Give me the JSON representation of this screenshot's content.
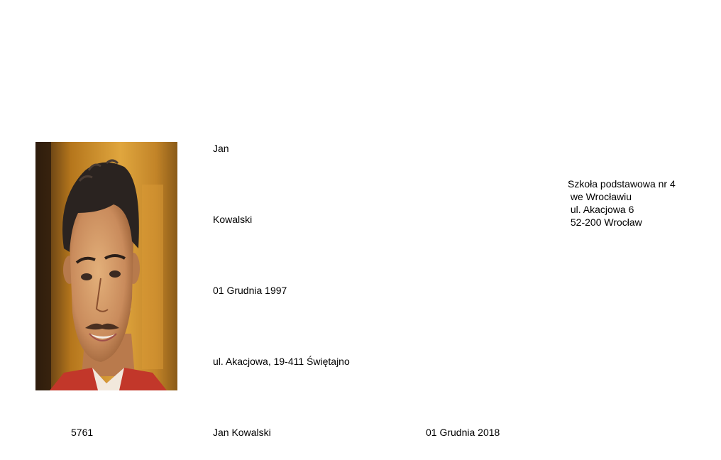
{
  "card": {
    "first_name": "Jan",
    "last_name": "Kowalski",
    "birth_date": "01 Grudnia 1997",
    "address": "ul. Akacjowa, 19-411 Świętajno",
    "number": "5761",
    "full_name": "Jan Kowalski",
    "issue_date": "01 Grudnia 2018"
  },
  "school": {
    "lines": [
      "Szkoła podstawowa nr 4",
      " we Wrocławiu",
      " ul. Akacjowa 6",
      " 52-200 Wrocław"
    ]
  },
  "photo": {
    "icon": "portrait-photo",
    "bg_color": "#c98a2a",
    "skin_color": "#c98b5c",
    "hair_color": "#2a2320",
    "shirt_color": "#c2372a"
  }
}
